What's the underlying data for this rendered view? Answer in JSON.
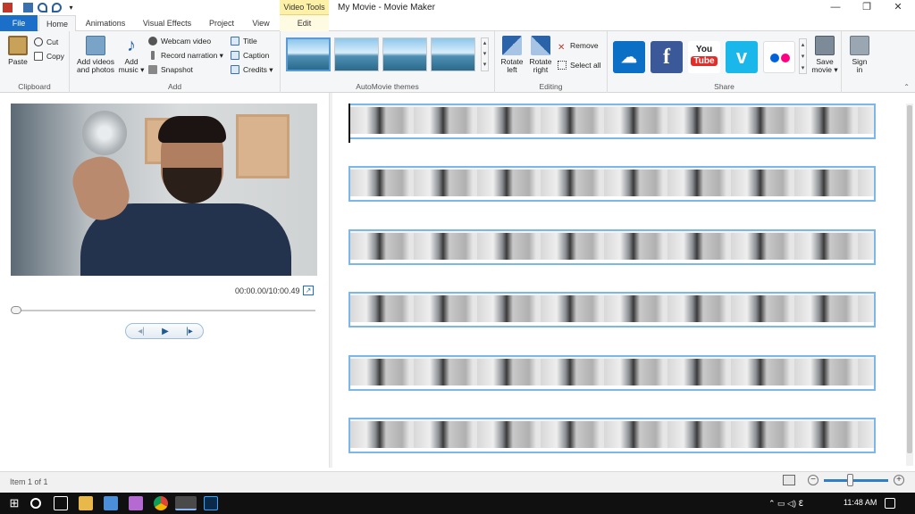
{
  "window": {
    "title": "My Movie - Movie Maker",
    "context_tab": "Video Tools",
    "controls": {
      "minimize": "—",
      "restore": "❐",
      "close": "✕"
    }
  },
  "tabs": {
    "file": "File",
    "home": "Home",
    "animations": "Animations",
    "visual_effects": "Visual Effects",
    "project": "Project",
    "view": "View",
    "edit": "Edit"
  },
  "ribbon": {
    "clipboard": {
      "label": "Clipboard",
      "paste": "Paste",
      "cut": "Cut",
      "copy": "Copy"
    },
    "add": {
      "label": "Add",
      "add_videos_l1": "Add videos",
      "add_videos_l2": "and photos",
      "add_music_l1": "Add",
      "add_music_l2": "music ▾",
      "webcam": "Webcam video",
      "record": "Record narration ▾",
      "snapshot": "Snapshot",
      "title": "Title",
      "caption": "Caption",
      "credits": "Credits ▾"
    },
    "themes": {
      "label": "AutoMovie themes"
    },
    "editing": {
      "label": "Editing",
      "rotate_left_l1": "Rotate",
      "rotate_left_l2": "left",
      "rotate_right_l1": "Rotate",
      "rotate_right_l2": "right",
      "remove": "Remove",
      "select_all": "Select all"
    },
    "share": {
      "label": "Share",
      "save_movie_l1": "Save",
      "save_movie_l2": "movie ▾",
      "sign_in_l1": "Sign",
      "sign_in_l2": "in",
      "youtube_l1": "You",
      "youtube_l2": "Tube"
    }
  },
  "preview": {
    "timecode": "00:00.00/10:00.49",
    "playback_fraction": 0.0,
    "prev_frame": "◂|",
    "play": "▶",
    "next_frame": "|▸"
  },
  "storyboard": {
    "strip_count": 6
  },
  "status": {
    "text": "Item 1 of 1",
    "zoom_fraction": 0.4
  },
  "taskbar": {
    "time": "11:48 AM"
  },
  "colors": {
    "accent": "#1b6fc8",
    "context_tab": "#fdf1a8",
    "strip_border": "#7bb7e8"
  }
}
